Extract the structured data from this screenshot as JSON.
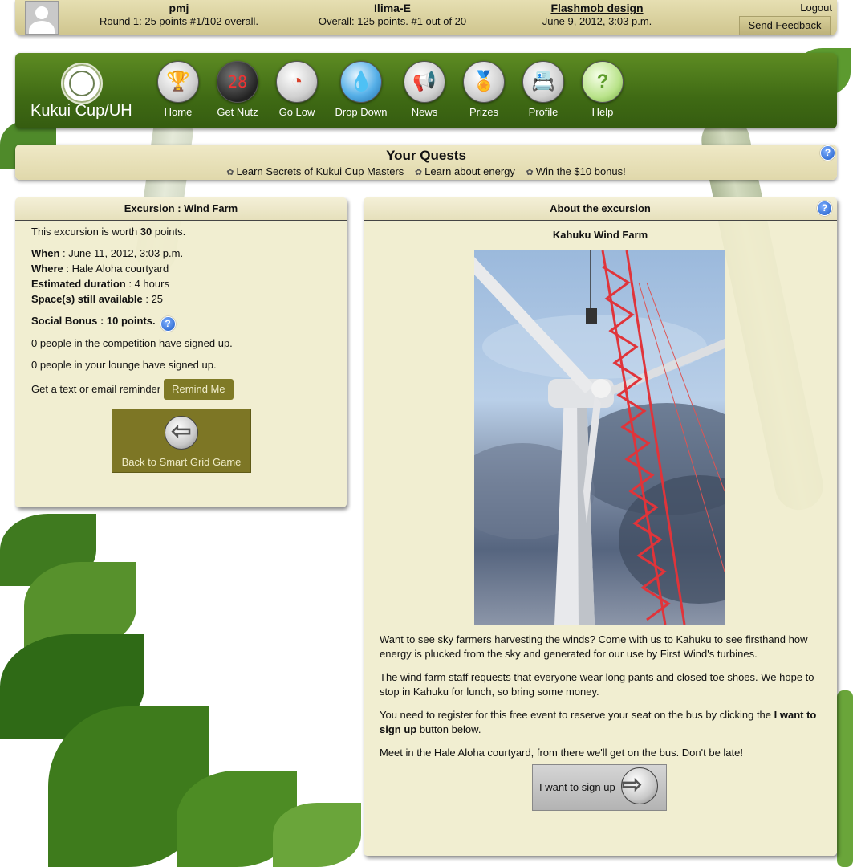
{
  "topbar": {
    "user": "pmj",
    "round_status": "Round 1: 25 points #1/102 overall.",
    "team": "Ilima-E",
    "team_status": "Overall: 125 points. #1 out of 20",
    "event_link": "Flashmob design",
    "event_date": "June 9, 2012, 3:03 p.m.",
    "logout": "Logout",
    "feedback": "Send Feedback"
  },
  "nav": {
    "brand": "Kukui Cup/UH",
    "items": [
      {
        "label": "Home",
        "icon": "trophy-icon"
      },
      {
        "label": "Get Nutz",
        "icon": "scoreboard-icon"
      },
      {
        "label": "Go Low",
        "icon": "gauge-icon"
      },
      {
        "label": "Drop Down",
        "icon": "water-drop-icon"
      },
      {
        "label": "News",
        "icon": "megaphone-icon"
      },
      {
        "label": "Prizes",
        "icon": "ribbon-icon"
      },
      {
        "label": "Profile",
        "icon": "id-card-icon"
      },
      {
        "label": "Help",
        "icon": "question-icon"
      }
    ]
  },
  "quests": {
    "title": "Your Quests",
    "items": [
      "Learn Secrets of Kukui Cup Masters",
      "Learn about energy",
      "Win the $10 bonus!"
    ]
  },
  "left": {
    "header": "Excursion : Wind Farm",
    "worth_prefix": "This excursion is worth ",
    "worth_points": "30",
    "worth_suffix": " points.",
    "when_label": "When",
    "when_value": " : June 11, 2012, 3:03 p.m.",
    "where_label": "Where",
    "where_value": " : Hale Aloha courtyard",
    "duration_label": "Estimated duration",
    "duration_value": " : 4 hours",
    "spaces_label": "Space(s) still available",
    "spaces_value": " : 25",
    "social_bonus": "Social Bonus : 10 points.",
    "competition_signups": "0 people in the competition have signed up.",
    "lounge_signups": "0 people in your lounge have signed up.",
    "reminder_text": "Get a text or email reminder",
    "remind_button": "Remind Me",
    "back_button": "Back to Smart Grid Game"
  },
  "right": {
    "header": "About the excursion",
    "subtitle": "Kahuku Wind Farm",
    "p1": "Want to see sky farmers harvesting the winds? Come with us to Kahuku to see firsthand how energy is plucked from the sky and generated for our use by First Wind's turbines.",
    "p2": "The wind farm staff requests that everyone wear long pants and closed toe shoes. We hope to stop in Kahuku for lunch, so bring some money.",
    "p3_prefix": "You need to register for this free event to reserve your seat on the bus by clicking the ",
    "p3_bold": "I want to sign up",
    "p3_suffix": " button below.",
    "p4": "Meet in the Hale Aloha courtyard, from there we'll get on the bus. Don't be late!",
    "signup_button": "I want to sign up"
  },
  "colors": {
    "nav_green": "#3f6a14",
    "panel_bg": "#f0edcd",
    "button_olive": "#7d7625",
    "crane_red": "#e0343a"
  }
}
